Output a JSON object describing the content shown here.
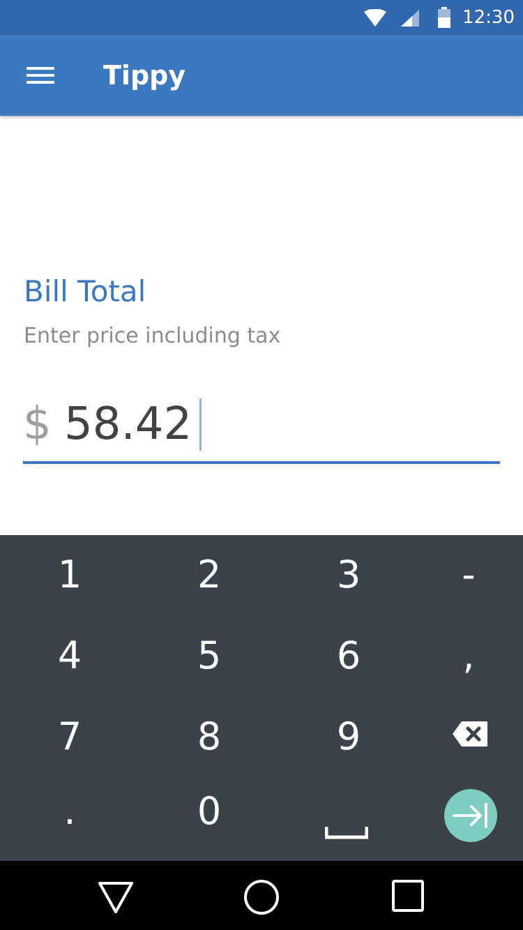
{
  "status_bar": {
    "time": "12:30",
    "icons": [
      "wifi-icon",
      "signal-icon",
      "battery-icon"
    ]
  },
  "app_bar": {
    "title": "Tippy",
    "menu_icon": "menu-icon"
  },
  "bill_field": {
    "label": "Bill Total",
    "helper": "Enter price including tax",
    "currency": "$",
    "value": "58.42"
  },
  "keyboard": {
    "rows": [
      [
        "1",
        "2",
        "3",
        "-"
      ],
      [
        "4",
        "5",
        "6",
        ","
      ],
      [
        "7",
        "8",
        "9",
        "backspace-icon"
      ],
      [
        ".",
        "0",
        "space-icon",
        "next-icon"
      ]
    ]
  },
  "nav_bar": {
    "icons": [
      "back-icon",
      "home-icon",
      "recents-icon"
    ]
  },
  "colors": {
    "status_bar": "#3167ad",
    "app_bar": "#3b78c0",
    "accent": "#3b78c0",
    "keyboard_bg": "#3b4249",
    "enter_key": "#7ecdc2",
    "nav_bar": "#000000"
  }
}
